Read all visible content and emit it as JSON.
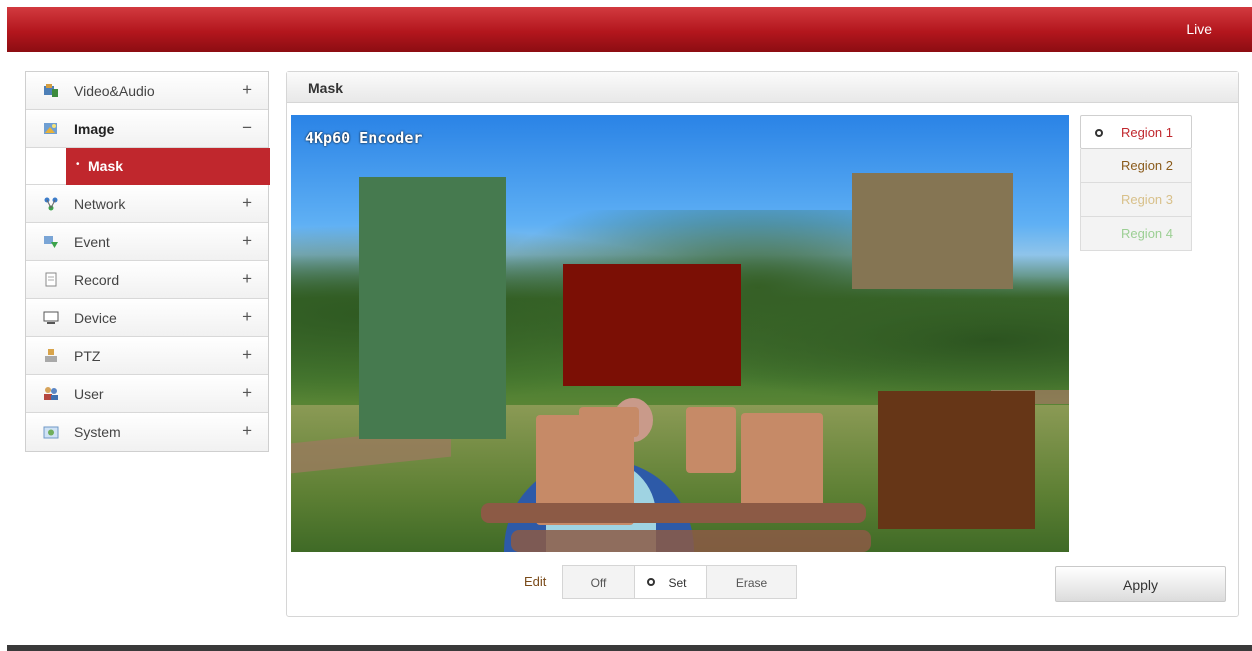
{
  "header": {
    "live_label": "Live",
    "accent": "#b3161d"
  },
  "sidebar": {
    "items": [
      {
        "label": "Video&Audio",
        "toggle": "+",
        "icon": "video-audio-icon"
      },
      {
        "label": "Image",
        "toggle": "−",
        "icon": "image-icon",
        "expanded": true,
        "subitems": [
          {
            "label": "Mask",
            "active": true
          }
        ]
      },
      {
        "label": "Network",
        "toggle": "+",
        "icon": "network-icon"
      },
      {
        "label": "Event",
        "toggle": "+",
        "icon": "event-icon"
      },
      {
        "label": "Record",
        "toggle": "+",
        "icon": "record-icon"
      },
      {
        "label": "Device",
        "toggle": "+",
        "icon": "device-icon"
      },
      {
        "label": "PTZ",
        "toggle": "+",
        "icon": "ptz-icon"
      },
      {
        "label": "User",
        "toggle": "+",
        "icon": "user-icon"
      },
      {
        "label": "System",
        "toggle": "+",
        "icon": "system-icon"
      }
    ]
  },
  "panel": {
    "title": "Mask"
  },
  "video": {
    "overlay_text": "4Kp60  Encoder",
    "masks": [
      {
        "name": "mask-green",
        "color": "#467a4f"
      },
      {
        "name": "mask-red",
        "color": "#7b0f05"
      },
      {
        "name": "mask-khaki",
        "color": "#857553"
      },
      {
        "name": "mask-brown",
        "color": "#663617"
      }
    ]
  },
  "regions": [
    {
      "label": "Region 1",
      "color": "#c0272d",
      "selected": true
    },
    {
      "label": "Region 2",
      "color": "#8a5a1a"
    },
    {
      "label": "Region 3",
      "color": "#d8c08a"
    },
    {
      "label": "Region 4",
      "color": "#9ccf94"
    }
  ],
  "edit": {
    "label": "Edit",
    "options": [
      "Off",
      "Set",
      "Erase"
    ],
    "selected": "Set"
  },
  "apply_label": "Apply"
}
